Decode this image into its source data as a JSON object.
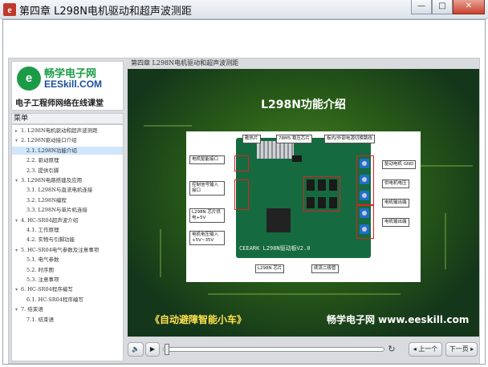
{
  "window": {
    "title": "第四章 L298N电机驱动和超声波测距",
    "minimize": "—",
    "maximize": "□",
    "close": "✕"
  },
  "logo": {
    "mark": "e",
    "cn": "畅学电子网",
    "en": "EESkill.COM",
    "slogan": "电子工程师网络在线课堂"
  },
  "menu": {
    "header": "菜单",
    "items": [
      {
        "text": "1. L298N电机驱动和超声波测距",
        "level": 0,
        "expanded": false
      },
      {
        "text": "2. L298N驱动接口介绍",
        "level": 0,
        "expanded": true
      },
      {
        "text": "2.1. L298N功能介绍",
        "level": 1,
        "selected": true
      },
      {
        "text": "2.2. 驱动原理",
        "level": 1
      },
      {
        "text": "2.3. 提供引脚",
        "level": 1
      },
      {
        "text": "3. L298N电路搭建及应用",
        "level": 0,
        "expanded": true
      },
      {
        "text": "3.1. L298N与直流电机连接",
        "level": 1
      },
      {
        "text": "3.2. L298N编程",
        "level": 1
      },
      {
        "text": "3.3. L298N与单片机连接",
        "level": 1
      },
      {
        "text": "4. HC-SR04超声波介绍",
        "level": 0,
        "expanded": true
      },
      {
        "text": "4.1. 工作原理",
        "level": 1
      },
      {
        "text": "4.2. 实物与引脚功能",
        "level": 1
      },
      {
        "text": "5. HC-SR04电气参数及注意事项",
        "level": 0,
        "expanded": true
      },
      {
        "text": "5.1. 电气参数",
        "level": 1
      },
      {
        "text": "5.2. 时序图",
        "level": 1
      },
      {
        "text": "5.3. 注意事项",
        "level": 1
      },
      {
        "text": "6. HC-SR04程序编写",
        "level": 0,
        "expanded": true
      },
      {
        "text": "6.1. HC-SR04程序编写",
        "level": 1
      },
      {
        "text": "7. 结束语",
        "level": 0,
        "expanded": true
      },
      {
        "text": "7.1. 结束语",
        "level": 1
      }
    ]
  },
  "lesson": {
    "title": "第四章 L298N电机驱动和超声波测距"
  },
  "slide": {
    "title": "L298N功能介绍",
    "pcb_text": "CEEARK  L298N驱动板V2.0",
    "annotations": {
      "heatsink": "散热片",
      "reg": "78M5 稳压芯片",
      "switch": "板内/外部电源切换跳线",
      "gnd": "驱动电机 GND",
      "enable": "电机驱能接口",
      "vcc": "供电机电压",
      "ctrl": "控制信号输入接口",
      "out1": "电机输出端",
      "chip5v": "L298N 芯片供电+5V",
      "out2": "电机输出端",
      "vin": "电机电压输入+5V~35V",
      "chip": "L298N 芯片",
      "diode": "续流二极管"
    },
    "banner_left": "《自动避障智能小车》",
    "banner_right": "畅学电子网  www.eeskill.com"
  },
  "controls": {
    "volume_icon": "🔈",
    "play_icon": "▶",
    "reload_icon": "↻",
    "prev": "◂ 上一个",
    "next": "下一页 ▸"
  },
  "colors": {
    "accent": "#1c9b47",
    "selected_row": "#cfe6fb",
    "banner_yellow": "#ffe14d"
  }
}
